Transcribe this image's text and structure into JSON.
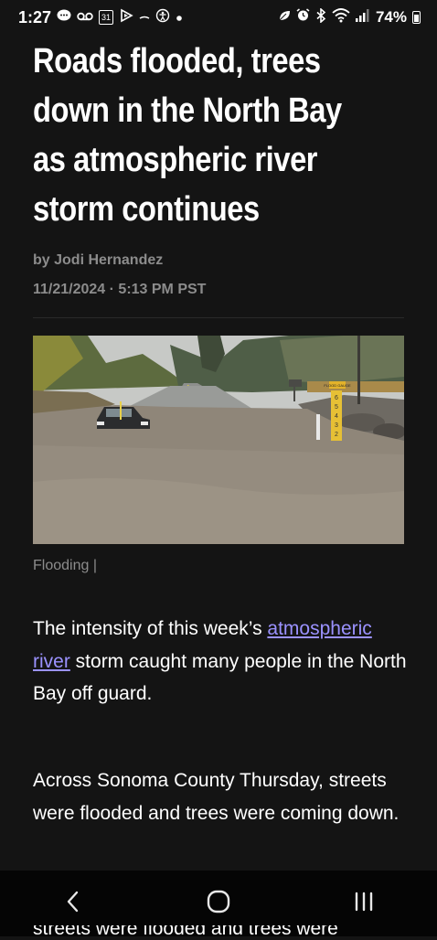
{
  "status_bar": {
    "time": "1:27",
    "battery": "74%",
    "left_icons": [
      "chat-icon",
      "voicemail-icon",
      "calendar-icon",
      "play-icon",
      "minus-icon",
      "accessibility-icon",
      "dot-icon"
    ],
    "right_icons": [
      "leaf-icon",
      "alarm-icon",
      "bluetooth-icon",
      "wifi-icon",
      "signal-icon",
      "battery-icon"
    ],
    "calendar_day": "31"
  },
  "article": {
    "headline_lines": [
      "Roads flooded, trees",
      "down in the North Bay",
      "as atmospheric river",
      "storm continues"
    ],
    "byline": "by Jodi Hernandez",
    "timestamp": "11/21/2024 · 5:13 PM PST",
    "image_caption": "Flooding |",
    "flood_gauge_label": "FLOOD GAUGE",
    "gauge_numbers": [
      "6",
      "5",
      "4",
      "3",
      "2"
    ],
    "para1_before": "The intensity of this week’s ",
    "para1_link": "atmospheric river",
    "para1_after": " storm caught many people in the North Bay off guard.",
    "para2": "Across Sonoma County Thursday, streets were flooded and trees were coming down.",
    "para3_partial": "streets were flooded and trees were"
  },
  "colors": {
    "background": "#141414",
    "link": "#9b92ff",
    "muted_text": "#8c8c8c",
    "nav_bar": "#050505"
  },
  "nav": {
    "back": "back-icon",
    "home": "home-icon",
    "recents": "recents-icon"
  }
}
